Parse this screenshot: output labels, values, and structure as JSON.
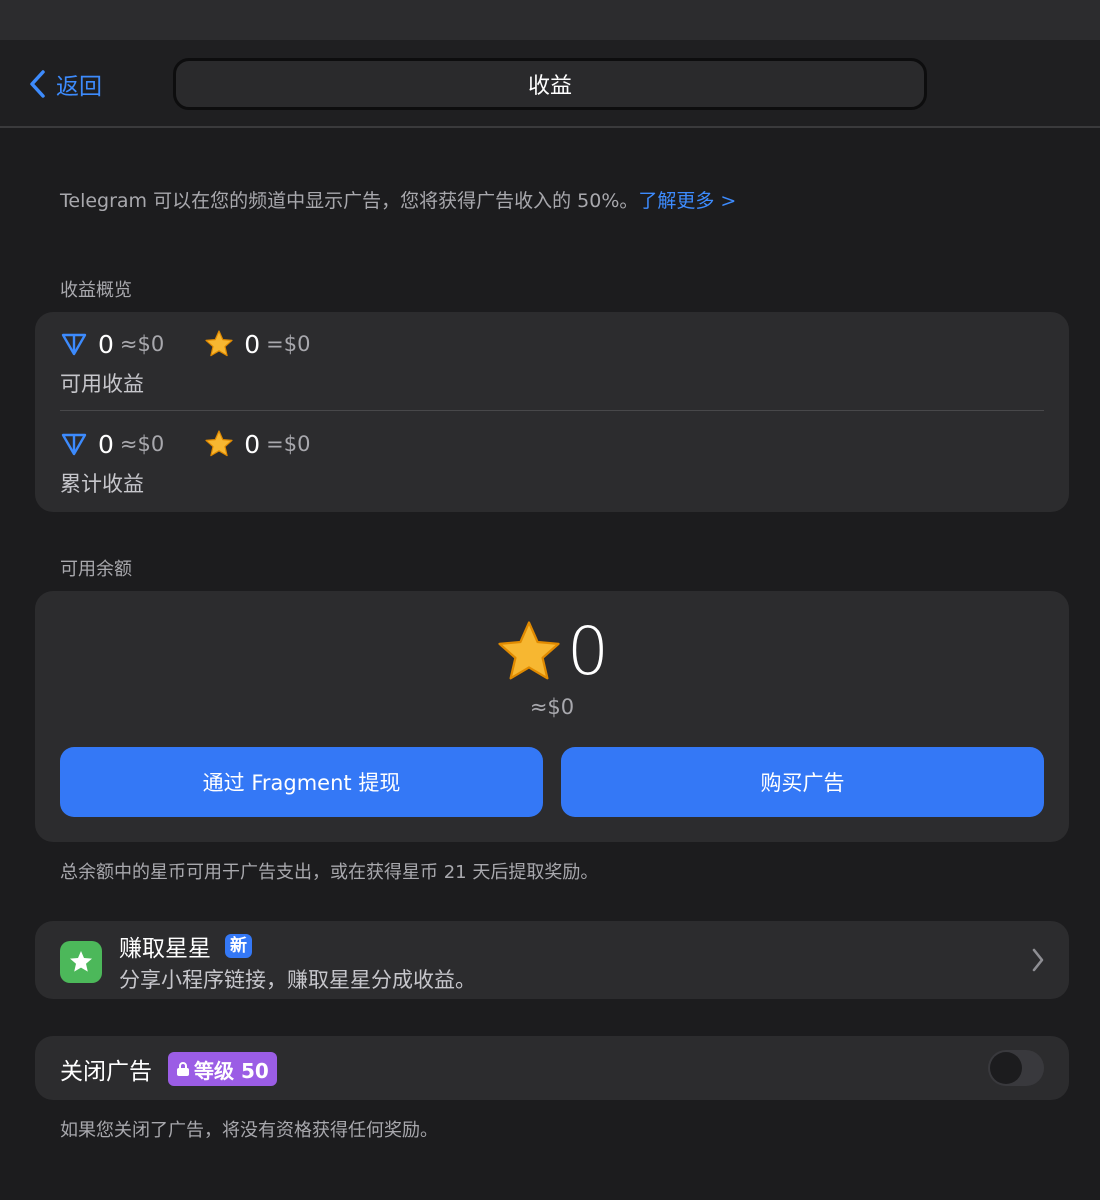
{
  "nav": {
    "back_label": "返回",
    "title": "收益"
  },
  "intro": {
    "text": "Telegram 可以在您的频道中显示广告，您将获得广告收入的 50%。",
    "link": "了解更多 >"
  },
  "overview": {
    "label": "收益概览",
    "available": {
      "ton_amount": "0",
      "ton_usd": "≈$0",
      "stars_amount": "0",
      "stars_usd": "=$0",
      "caption": "可用收益"
    },
    "total": {
      "ton_amount": "0",
      "ton_usd": "≈$0",
      "stars_amount": "0",
      "stars_usd": "=$0",
      "caption": "累计收益"
    }
  },
  "balance": {
    "label": "可用余额",
    "amount": "0",
    "usd": "≈$0",
    "withdraw_button": "通过 Fragment 提现",
    "buy_ads_button": "购买广告",
    "note": "总余额中的星币可用于广告支出，或在获得星币 21 天后提取奖励。"
  },
  "earn_stars": {
    "title": "赚取星星",
    "badge": "新",
    "subtitle": "分享小程序链接，赚取星星分成收益。"
  },
  "disable_ads": {
    "title": "关闭广告",
    "level_badge": "等级 50",
    "enabled": false,
    "note": "如果您关闭了广告，将没有资格获得任何奖励。"
  },
  "colors": {
    "accent": "#3478f6",
    "link": "#3d8bfd",
    "level_badge": "#9b5de5",
    "earn_icon_bg": "#4cb85a"
  },
  "icons": [
    "back-chevron-icon",
    "ton-diamond-icon",
    "star-coin-icon",
    "earn-stars-icon",
    "chevron-right-icon",
    "lock-icon"
  ]
}
